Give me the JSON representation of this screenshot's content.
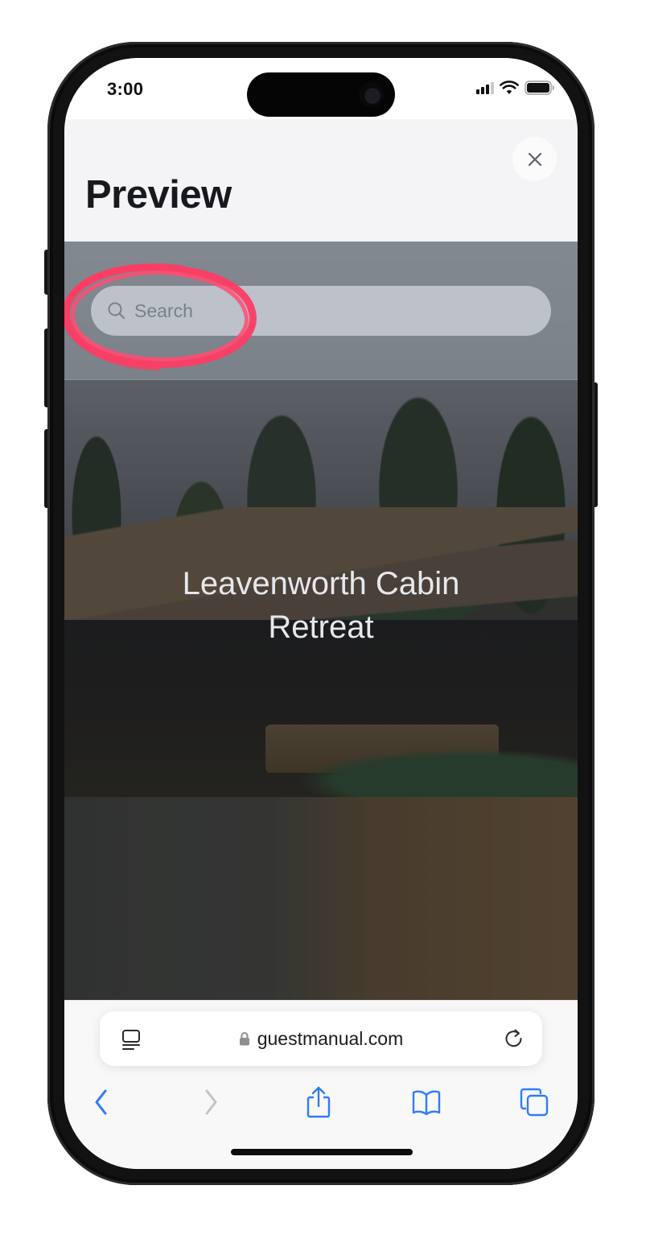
{
  "status_bar": {
    "time": "3:00",
    "signal_bars_active": 3,
    "signal_bars_total": 4,
    "battery_level": 1.0
  },
  "sheet": {
    "title": "Preview",
    "close_icon": "close-icon"
  },
  "preview": {
    "search": {
      "placeholder": "Search",
      "icon": "search-icon"
    },
    "annotation": {
      "type": "hand-drawn-circle",
      "target": "search-field",
      "color": "#ff3b63"
    },
    "hero_title": "Leavenworth Cabin Retreat"
  },
  "browser": {
    "url": "guestmanual.com",
    "secure": true,
    "reader_icon": "reader-mode-icon",
    "reload_icon": "reload-icon",
    "toolbar": [
      {
        "name": "back",
        "icon": "chevron-left-icon",
        "enabled": true
      },
      {
        "name": "forward",
        "icon": "chevron-right-icon",
        "enabled": false
      },
      {
        "name": "share",
        "icon": "share-icon",
        "enabled": true
      },
      {
        "name": "bookmarks",
        "icon": "book-icon",
        "enabled": true
      },
      {
        "name": "tabs",
        "icon": "tabs-icon",
        "enabled": true
      }
    ],
    "accent_color": "#2f7cf6",
    "disabled_color": "#c4c4c8"
  }
}
